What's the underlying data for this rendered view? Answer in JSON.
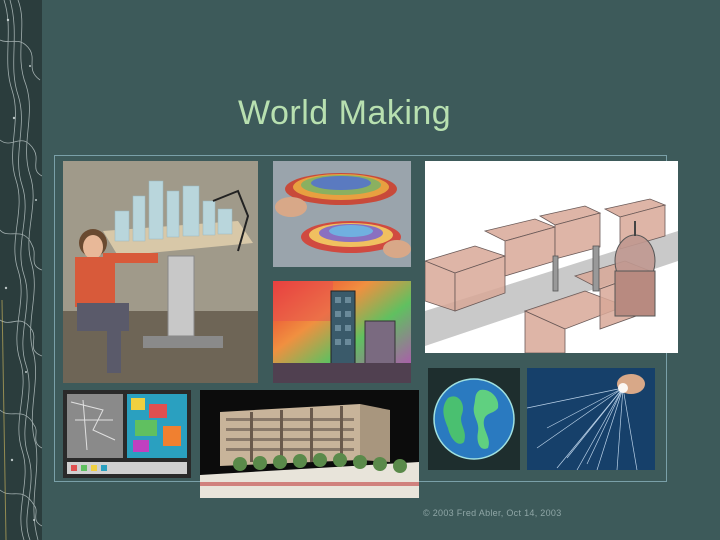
{
  "slide": {
    "title": "World Making",
    "footer": "© 2003  Fred Abler, Oct 14, 2003"
  },
  "images": [
    {
      "name": "person-at-model-table-photo"
    },
    {
      "name": "hands-layered-terrain-photo"
    },
    {
      "name": "3d-city-model-render"
    },
    {
      "name": "thermal-building-visualization"
    },
    {
      "name": "map-screens-photo"
    },
    {
      "name": "architectural-building-model-photo"
    },
    {
      "name": "globe-visualization"
    },
    {
      "name": "fiber-optic-light-photo"
    }
  ],
  "colors": {
    "background": "#3d5a5a",
    "title": "#b8e0b0",
    "frame": "#7aa0a8",
    "footer": "#8fa6a6"
  }
}
